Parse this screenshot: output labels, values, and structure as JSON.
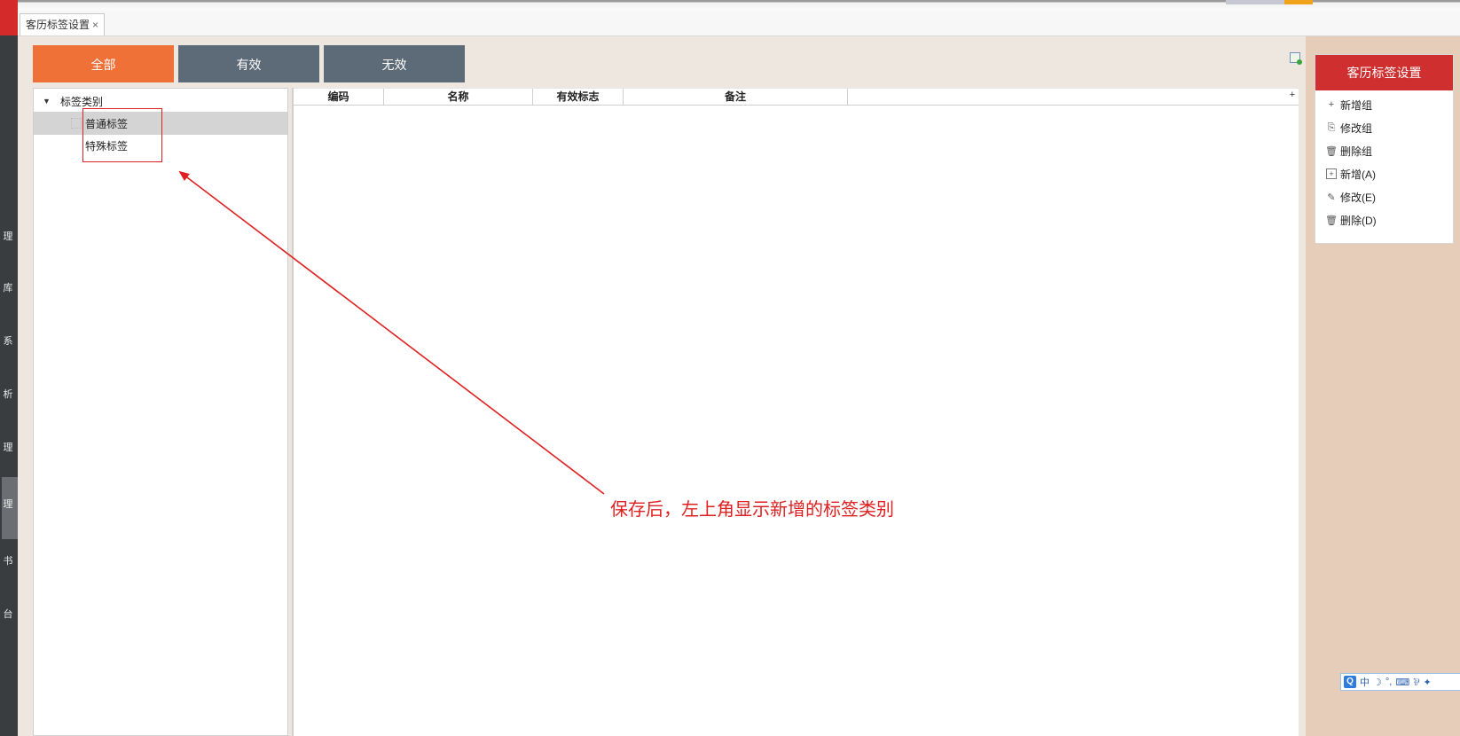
{
  "left_strip": {
    "chars": [
      "理",
      "库",
      "系",
      "析",
      "理",
      "理",
      "书",
      "台"
    ]
  },
  "tab": {
    "title": "客历标签设置",
    "close": "×"
  },
  "filters": {
    "all": "全部",
    "valid": "有效",
    "invalid": "无效"
  },
  "tree": {
    "root": "标签类别",
    "root_arrow": "▼",
    "items": [
      {
        "label": "普通标签",
        "selected": true
      },
      {
        "label": "特殊标签",
        "selected": false
      }
    ]
  },
  "grid": {
    "columns": [
      "编码",
      "名称",
      "有效标志",
      "备注"
    ],
    "plus": "+"
  },
  "annotation": "保存后，左上角显示新增的标签类别",
  "side_panel": {
    "title": "客历标签设置",
    "items": [
      {
        "icon": "plus-icon",
        "glyph": "+",
        "label": "新增组"
      },
      {
        "icon": "copy-icon",
        "glyph": "⎘",
        "label": "修改组"
      },
      {
        "icon": "trash-icon",
        "glyph": "🗑",
        "label": "删除组"
      },
      {
        "icon": "add-box-icon",
        "glyph": "+",
        "label": "新增(A)"
      },
      {
        "icon": "edit-icon",
        "glyph": "✎",
        "label": "修改(E)"
      },
      {
        "icon": "trash-icon",
        "glyph": "🗑",
        "label": "删除(D)"
      }
    ]
  },
  "ime": {
    "logo": "Q",
    "lang": "中",
    "items": [
      "☽",
      "°,",
      "⌨",
      "⅌",
      "✦"
    ]
  },
  "colors": {
    "accent_orange": "#f07138",
    "button_slate": "#5d6a77",
    "panel_red": "#cf2f2f",
    "annotation_red": "#e02020",
    "main_bg": "#ede7e0",
    "right_bg": "#e5cdb9"
  }
}
